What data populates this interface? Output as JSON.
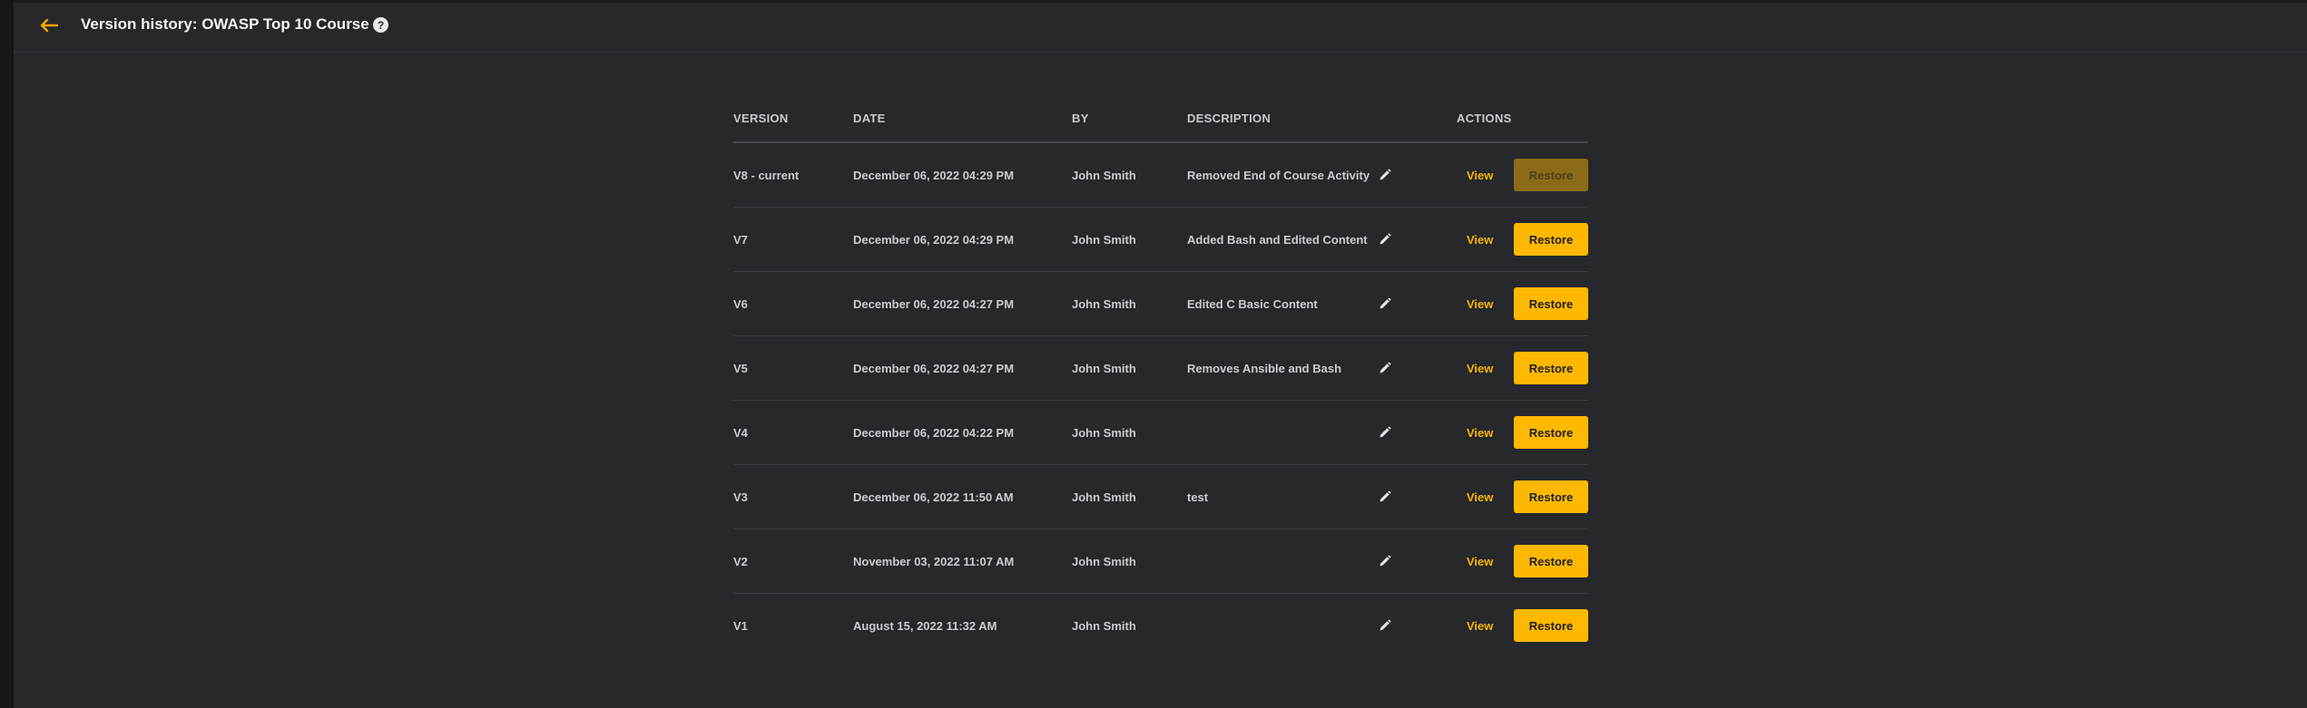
{
  "header": {
    "title": "Version history: OWASP Top 10 Course",
    "back_icon": "arrow-left-icon",
    "help_icon": "question-circle-icon",
    "help_glyph": "?"
  },
  "table": {
    "columns": {
      "version": "VERSION",
      "date": "DATE",
      "by": "BY",
      "description": "DESCRIPTION",
      "actions": "ACTIONS"
    },
    "rows": [
      {
        "version": "V8 - current",
        "date": "December 06, 2022 04:29 PM",
        "by": "John Smith",
        "description": "Removed End of Course Activity",
        "view": "View",
        "restore": "Restore"
      },
      {
        "version": "V7",
        "date": "December 06, 2022 04:29 PM",
        "by": "John Smith",
        "description": "Added Bash and Edited Content",
        "view": "View",
        "restore": "Restore"
      },
      {
        "version": "V6",
        "date": "December 06, 2022 04:27 PM",
        "by": "John Smith",
        "description": "Edited C Basic Content",
        "view": "View",
        "restore": "Restore"
      },
      {
        "version": "V5",
        "date": "December 06, 2022 04:27 PM",
        "by": "John Smith",
        "description": "Removes Ansible and Bash",
        "view": "View",
        "restore": "Restore"
      },
      {
        "version": "V4",
        "date": "December 06, 2022 04:22 PM",
        "by": "John Smith",
        "description": "",
        "view": "View",
        "restore": "Restore"
      },
      {
        "version": "V3",
        "date": "December 06, 2022 11:50 AM",
        "by": "John Smith",
        "description": "test",
        "view": "View",
        "restore": "Restore"
      },
      {
        "version": "V2",
        "date": "November 03, 2022 11:07 AM",
        "by": "John Smith",
        "description": "",
        "view": "View",
        "restore": "Restore"
      },
      {
        "version": "V1",
        "date": "August 15, 2022 11:32 AM",
        "by": "John Smith",
        "description": "",
        "view": "View",
        "restore": "Restore"
      }
    ]
  },
  "colors": {
    "accent": "#ffb800",
    "accent_disabled": "#8b6b18",
    "background": "#26282c"
  }
}
